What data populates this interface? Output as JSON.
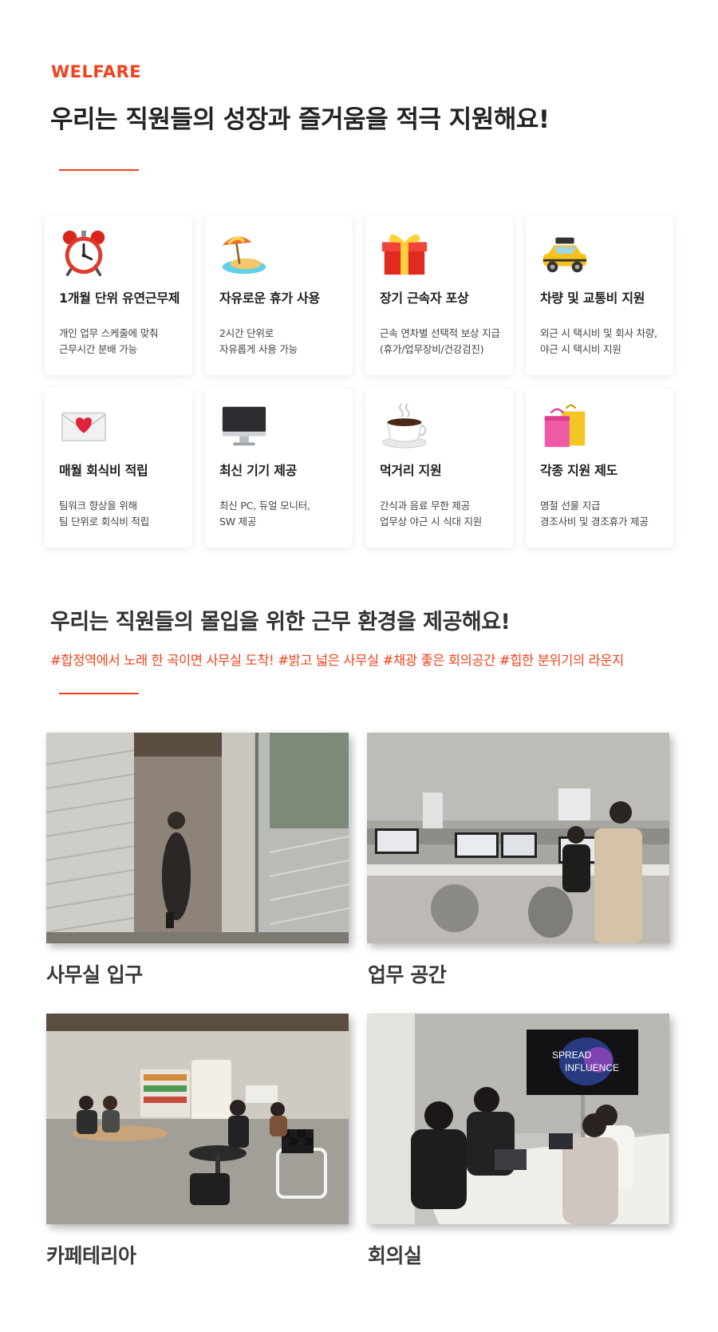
{
  "welfare": {
    "eyebrow": "WELFARE",
    "headline": "우리는 직원들의 성장과 즐거움을 적극 지원해요!",
    "accent_color": "#f0421c",
    "cards": [
      {
        "icon": "alarm-clock-icon",
        "title": "1개월 단위 유연근무제",
        "desc": [
          "개인 업무 스케줄에 맞춰",
          "근무시간 분배 가능"
        ]
      },
      {
        "icon": "beach-island-icon",
        "title": "자유로운 휴가 사용",
        "desc": [
          "2시간 단위로",
          "자유롭게 사용 가능"
        ]
      },
      {
        "icon": "gift-box-icon",
        "title": "장기 근속자 포상",
        "desc": [
          "근속 연차별 선택적 보상 지급",
          "(휴가/업무장비/건강검진)"
        ]
      },
      {
        "icon": "taxi-icon",
        "title": "차량 및 교통비 지원",
        "desc": [
          "외근 시 택시비 및 회사 차량,",
          "야근 시 택시비 지원"
        ]
      },
      {
        "icon": "love-letter-icon",
        "title": "매월 회식비 적립",
        "desc": [
          "팀워크 향상을 위해",
          "팀 단위로 회식비 적립"
        ]
      },
      {
        "icon": "desktop-computer-icon",
        "title": "최신 기기 제공",
        "desc": [
          "최신 PC, 듀얼 모니터,",
          "SW 제공"
        ]
      },
      {
        "icon": "hot-coffee-icon",
        "title": "먹거리 지원",
        "desc": [
          "간식과 음료 무한 제공",
          "업무상 야근 시 식대 지원"
        ]
      },
      {
        "icon": "shopping-bags-icon",
        "title": "각종 지원 제도",
        "desc": [
          "명절 선물 지급",
          "경조사비 및 경조휴가 제공"
        ]
      }
    ]
  },
  "environment": {
    "headline": "우리는 직원들의 몰입을 위한 근무 환경을 제공해요!",
    "hashtags": "#합정역에서 노래 한 곡이면 사무실 도착! #밝고 넓은 사무실 #채광 좋은 회의공간 #힙한 분위기의 라운지",
    "photos": [
      {
        "caption": "사무실 입구"
      },
      {
        "caption": "업무 공간"
      },
      {
        "caption": "카페테리아"
      },
      {
        "caption": "회의실",
        "screen_text": [
          "SPREAD",
          "INFLUENCE"
        ]
      }
    ]
  }
}
